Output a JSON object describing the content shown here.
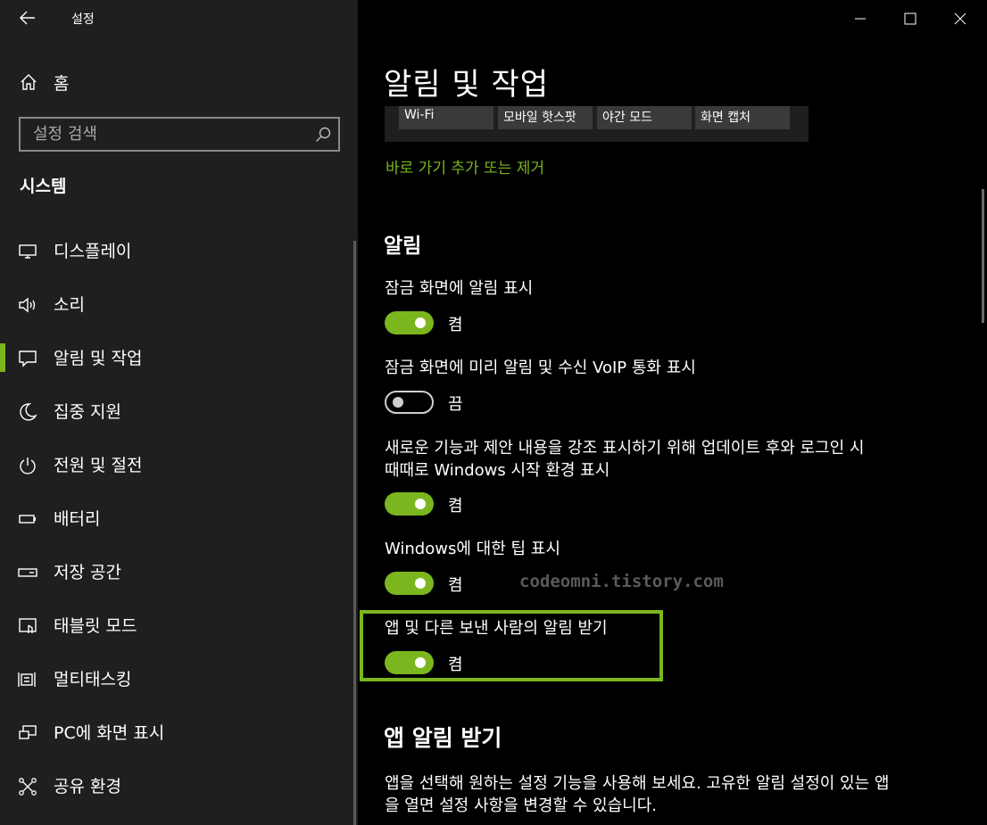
{
  "window": {
    "title": "설정"
  },
  "sidebar": {
    "home_label": "홈",
    "search_placeholder": "설정 검색",
    "section_title": "시스템",
    "items": [
      {
        "label": "디스플레이",
        "icon": "display-icon"
      },
      {
        "label": "소리",
        "icon": "speaker-icon"
      },
      {
        "label": "알림 및 작업",
        "icon": "notification-icon",
        "active": true
      },
      {
        "label": "집중 지원",
        "icon": "moon-icon"
      },
      {
        "label": "전원 및 절전",
        "icon": "power-icon"
      },
      {
        "label": "배터리",
        "icon": "battery-icon"
      },
      {
        "label": "저장 공간",
        "icon": "storage-icon"
      },
      {
        "label": "태블릿 모드",
        "icon": "tablet-icon"
      },
      {
        "label": "멀티태스킹",
        "icon": "multitasking-icon"
      },
      {
        "label": "PC에 화면 표시",
        "icon": "project-icon"
      },
      {
        "label": "공유 환경",
        "icon": "share-icon"
      }
    ]
  },
  "main": {
    "page_title": "알림 및 작업",
    "quick_actions": [
      "Wi-Fi",
      "모바일 핫스팟",
      "야간 모드",
      "화면 캡처"
    ],
    "quick_link": "바로 가기 추가 또는 제거",
    "notifications_heading": "알림",
    "settings": [
      {
        "label": "잠금 화면에 알림 표시",
        "on": true,
        "state": "켬"
      },
      {
        "label": "잠금 화면에 미리 알림 및 수신 VoIP 통화 표시",
        "on": false,
        "state": "끔"
      },
      {
        "label": "새로운 기능과 제안 내용을 강조 표시하기 위해 업데이트 후와 로그인 시 때때로 Windows 시작 환경 표시",
        "on": true,
        "state": "켬"
      },
      {
        "label": "Windows에 대한 팁 표시",
        "on": true,
        "state": "켬"
      },
      {
        "label": "앱 및 다른 보낸 사람의 알림 받기",
        "on": true,
        "state": "켬"
      }
    ],
    "watermark": "codeomni.tistory.com",
    "app_notifications_heading": "앱 알림 받기",
    "app_notifications_desc": "앱을 선택해 원하는 설정 기능을 사용해 보세요. 고유한 알림 설정이 있는 앱을 열면 설정 사항을 변경할 수 있습니다."
  },
  "colors": {
    "accent": "#7bb61f",
    "sidebar_bg": "#1f1f1f",
    "main_bg": "#000000"
  }
}
